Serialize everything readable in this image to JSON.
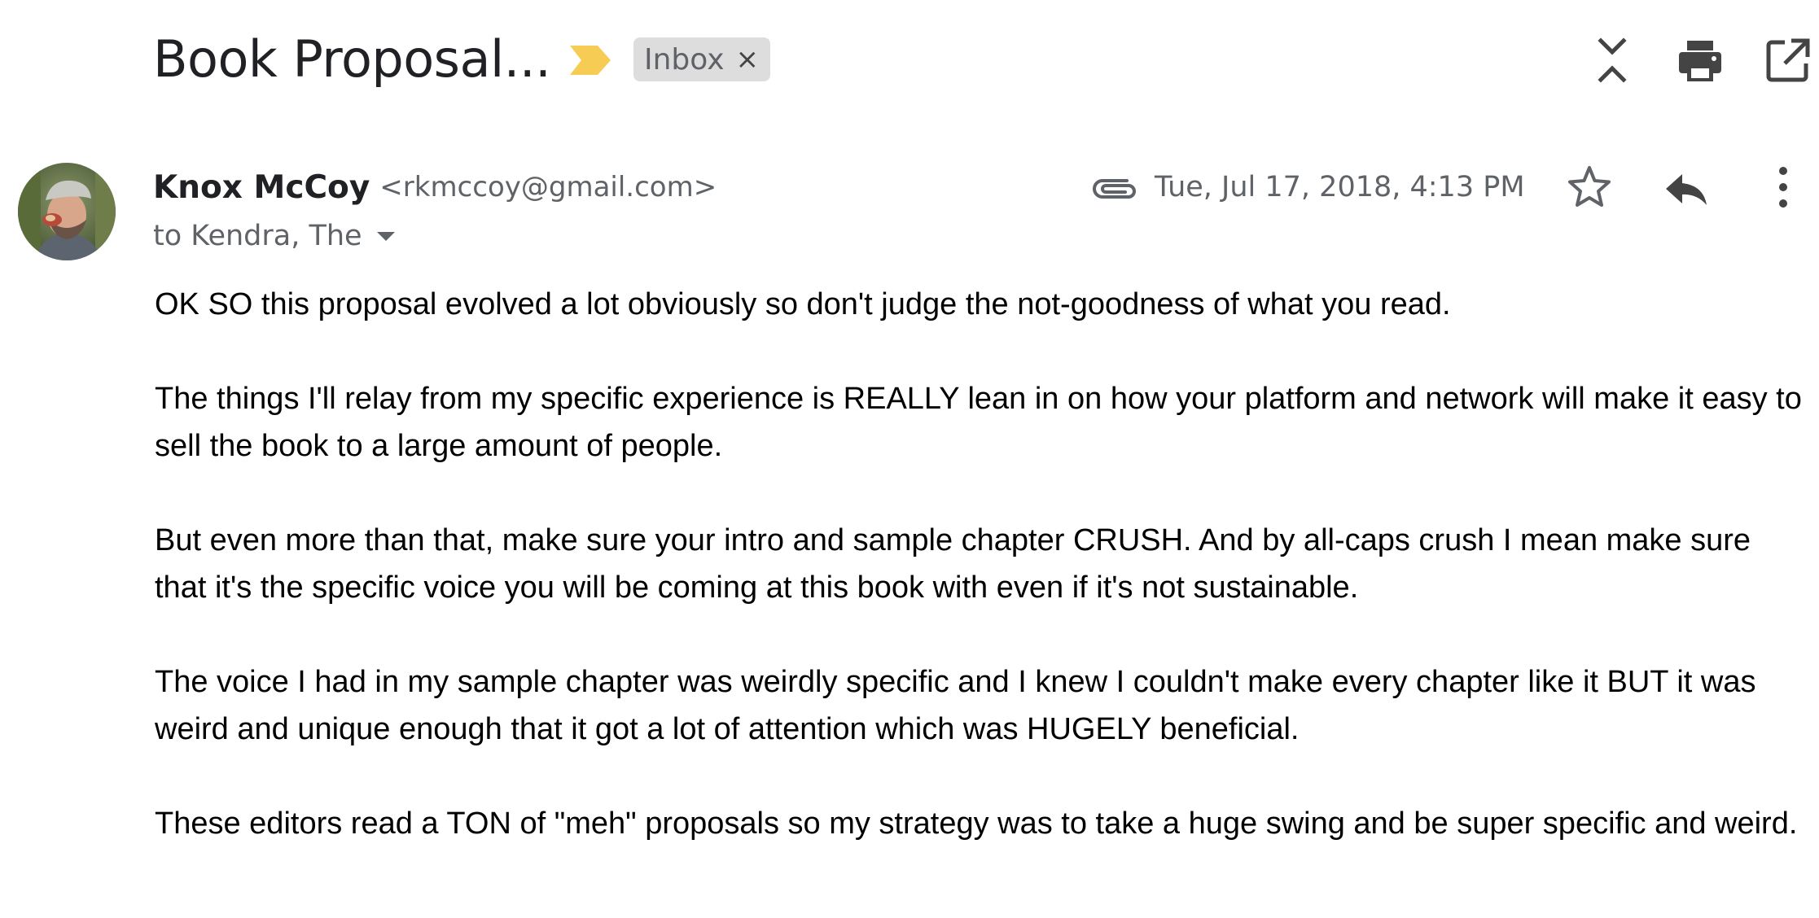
{
  "thread": {
    "subject": "Book Proposal...",
    "label": "Inbox",
    "label_remove_glyph": "×",
    "actions": [
      {
        "name": "collapse-all-icon"
      },
      {
        "name": "print-icon"
      },
      {
        "name": "open-in-new-window-icon"
      }
    ]
  },
  "message": {
    "sender_name": "Knox McCoy",
    "sender_email": "<rkmccoy@gmail.com>",
    "recipients": "to Kendra, The",
    "date": "Tue, Jul 17, 2018, 4:13 PM",
    "has_attachment": true,
    "icons": {
      "attachment": "paperclip-icon",
      "star": "star-outline-icon",
      "reply": "reply-icon",
      "more": "more-vert-icon",
      "importance": "importance-marker-icon"
    },
    "body": [
      "OK SO this proposal evolved a lot obviously so don't judge the not-goodness of what you read.",
      "The things I'll relay from my specific experience is REALLY lean in on how your platform and network will make it easy to sell the book to a large amount of people.",
      "But even more than that, make sure your intro and sample chapter CRUSH. And by all-caps crush I mean make sure that it's the specific voice you will be coming at this book with even if it's not sustainable.",
      "The voice I had in my sample chapter was weirdly specific and I knew I couldn't make every chapter like it BUT it was weird and unique enough that it got a lot of attention which was HUGELY beneficial.",
      "These editors read a TON of \"meh\" proposals so my strategy was to take a huge swing and be super specific and weird."
    ]
  },
  "colors": {
    "importance": "#f6cc55",
    "chip_bg": "#dddddd",
    "icon": "#444444",
    "secondary_text": "#5f6368",
    "body_text": "#000000"
  }
}
